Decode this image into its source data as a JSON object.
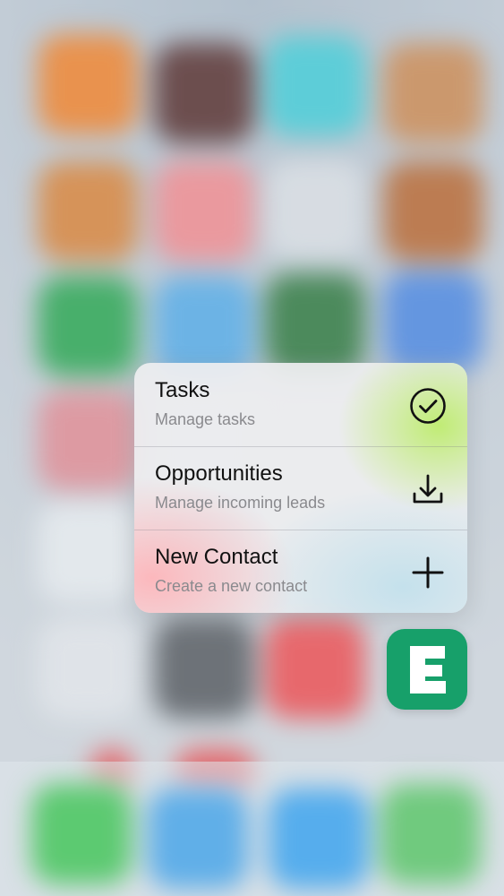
{
  "quick_actions": [
    {
      "title": "Tasks",
      "subtitle": "Manage tasks",
      "icon": "checkmark-circle-icon"
    },
    {
      "title": "Opportunities",
      "subtitle": "Manage incoming leads",
      "icon": "download-icon"
    },
    {
      "title": "New Contact",
      "subtitle": "Create a new contact",
      "icon": "plus-icon"
    }
  ],
  "app": {
    "icon": "evernote-style-e-icon",
    "color": "#17a06a"
  }
}
